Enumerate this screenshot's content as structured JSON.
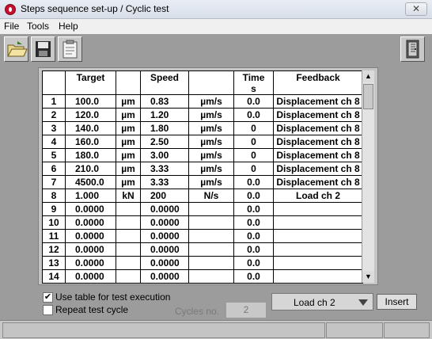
{
  "window": {
    "title": "Steps sequence set-up / Cyclic test",
    "close_label": "✕"
  },
  "menu": {
    "items": [
      "File",
      "Tools",
      "Help"
    ]
  },
  "toolbar": {
    "icons": [
      "open-folder-icon",
      "save-icon",
      "clipboard-icon",
      "exit-door-icon"
    ]
  },
  "table": {
    "headers": [
      "",
      "Target",
      "",
      "Speed",
      "",
      "Time\ns",
      "Feedback"
    ],
    "rows": [
      [
        "1",
        "100.0",
        "µm",
        "0.83",
        "µm/s",
        "0.0",
        "Displacement ch 8"
      ],
      [
        "2",
        "120.0",
        "µm",
        "1.20",
        "µm/s",
        "0.0",
        "Displacement ch 8"
      ],
      [
        "3",
        "140.0",
        "µm",
        "1.80",
        "µm/s",
        "0",
        "Displacement ch 8"
      ],
      [
        "4",
        "160.0",
        "µm",
        "2.50",
        "µm/s",
        "0",
        "Displacement ch 8"
      ],
      [
        "5",
        "180.0",
        "µm",
        "3.00",
        "µm/s",
        "0",
        "Displacement ch 8"
      ],
      [
        "6",
        "210.0",
        "µm",
        "3.33",
        "µm/s",
        "0",
        "Displacement ch 8"
      ],
      [
        "7",
        "4500.0",
        "µm",
        "3.33",
        "µm/s",
        "0.0",
        "Displacement ch 8"
      ],
      [
        "8",
        "1.000",
        "kN",
        "200",
        "N/s",
        "0.0",
        "Load ch 2"
      ],
      [
        "9",
        "0.0000",
        "",
        "0.0000",
        "",
        "0.0",
        ""
      ],
      [
        "10",
        "0.0000",
        "",
        "0.0000",
        "",
        "0.0",
        ""
      ],
      [
        "11",
        "0.0000",
        "",
        "0.0000",
        "",
        "0.0",
        ""
      ],
      [
        "12",
        "0.0000",
        "",
        "0.0000",
        "",
        "0.0",
        ""
      ],
      [
        "13",
        "0.0000",
        "",
        "0.0000",
        "",
        "0.0",
        ""
      ],
      [
        "14",
        "0.0000",
        "",
        "0.0000",
        "",
        "0.0",
        ""
      ]
    ]
  },
  "options": {
    "use_table_label": "Use table for test execution",
    "use_table_checked": true,
    "repeat_label": "Repeat test cycle",
    "repeat_checked": false,
    "cycles_label": "Cycles no.",
    "cycles_value": "2"
  },
  "feedback_select": {
    "value": "Load ch 2"
  },
  "insert_button": {
    "label": "Insert"
  }
}
